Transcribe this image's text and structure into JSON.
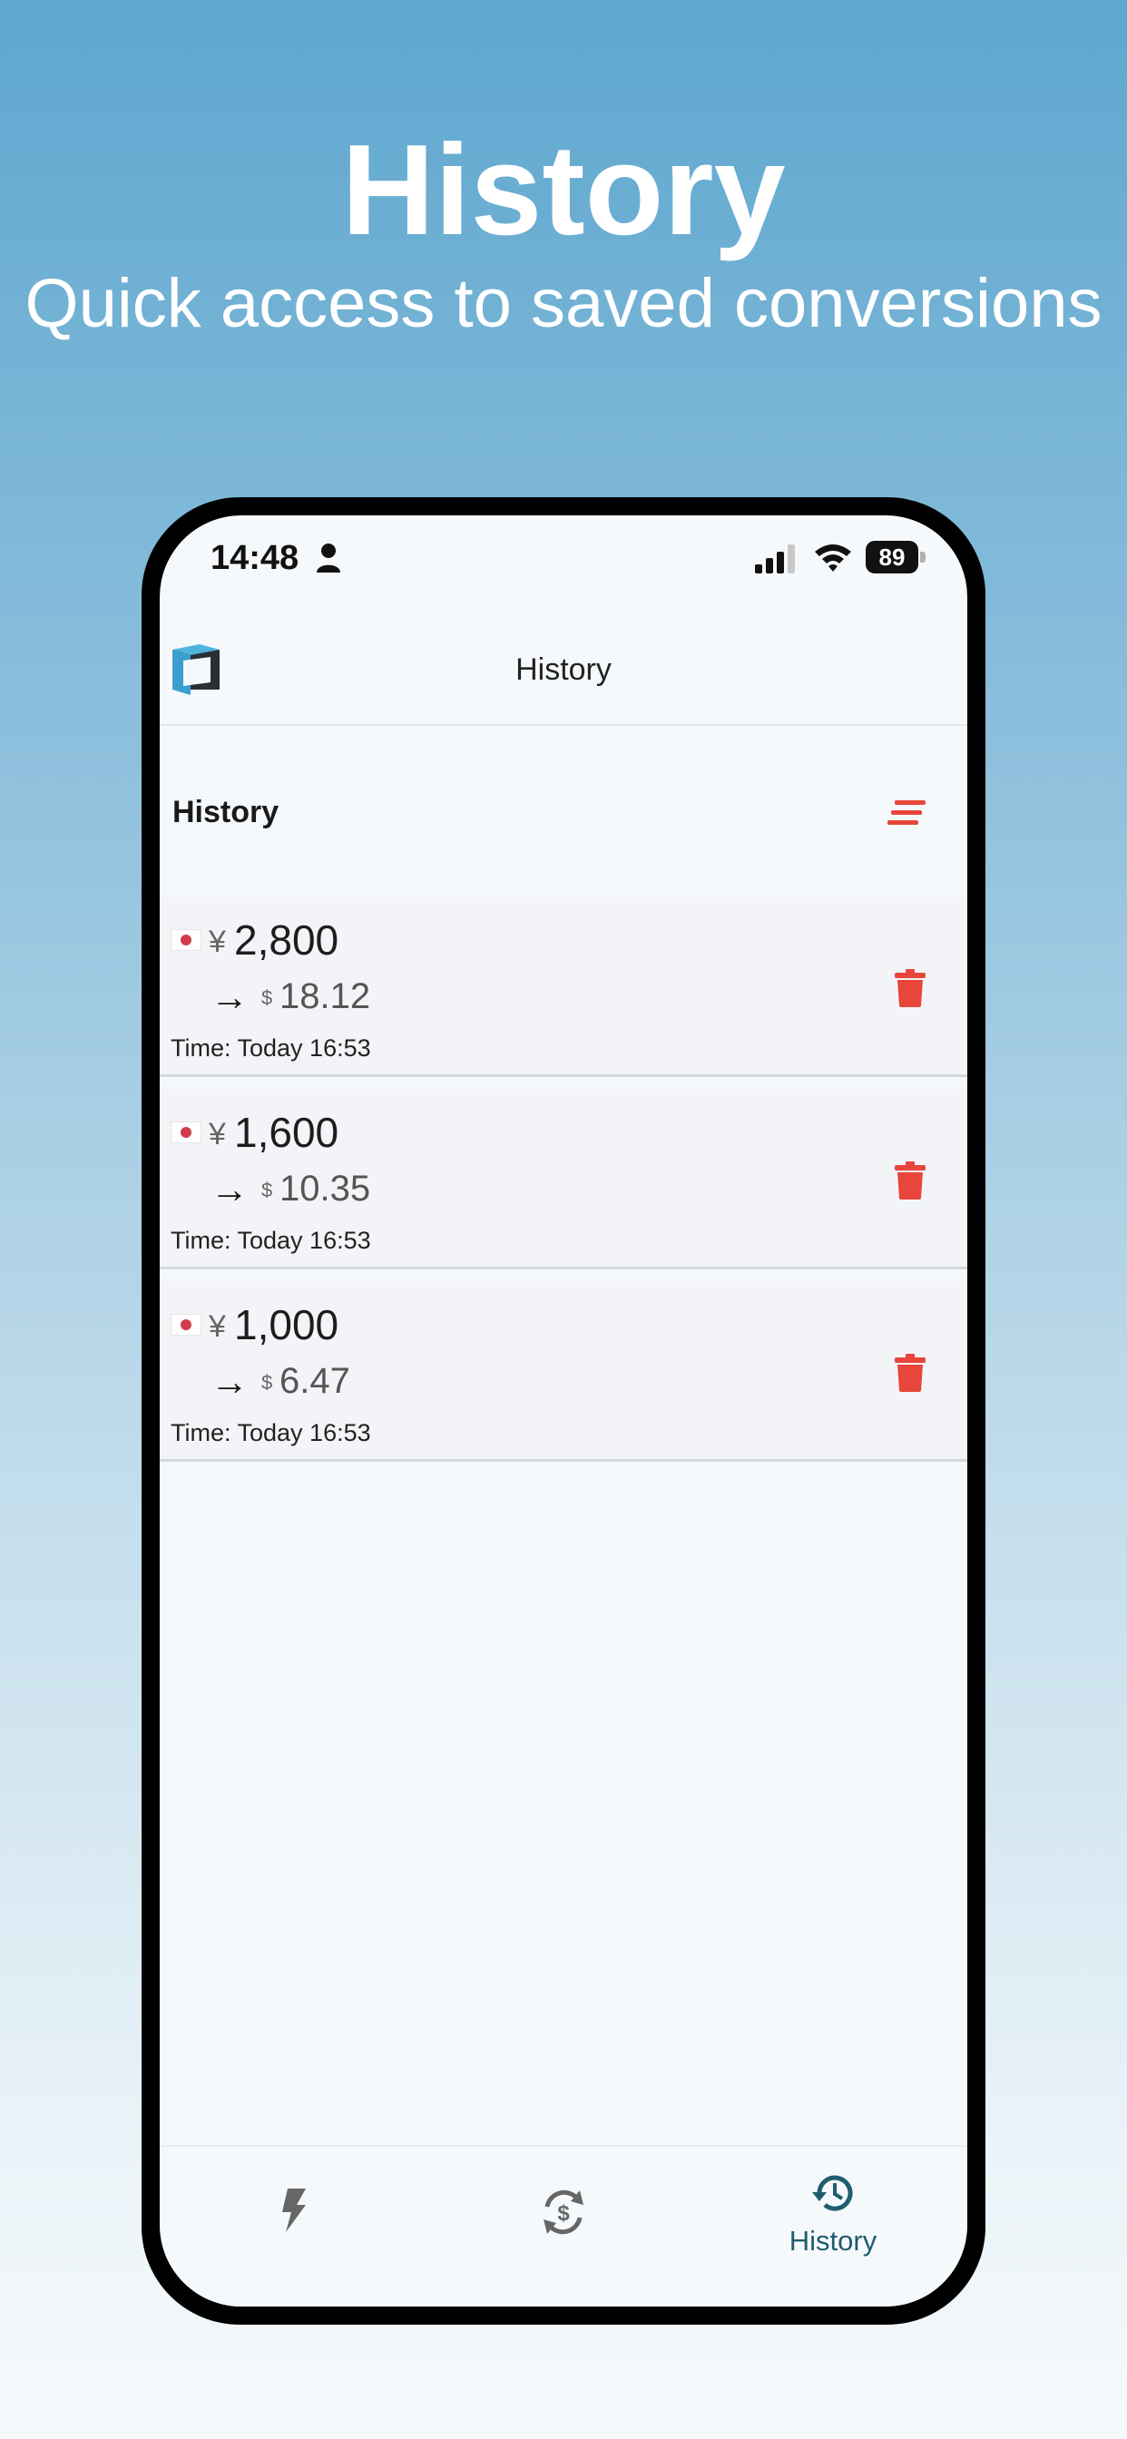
{
  "hero": {
    "title": "History",
    "subtitle": "Quick access to saved conversions"
  },
  "status_bar": {
    "time": "14:48",
    "battery": "89",
    "icons": [
      "person-icon",
      "signal-icon",
      "wifi-icon",
      "battery-icon"
    ]
  },
  "header": {
    "title": "History",
    "logo_icon": "app-logo-cube"
  },
  "section": {
    "title": "History",
    "sort_icon": "sort-lines-icon"
  },
  "history": [
    {
      "flag": "japan-flag-icon",
      "from_symbol": "¥",
      "from_amount": "2,800",
      "arrow": "→",
      "to_symbol": "$",
      "to_amount": "18.12",
      "time": "Time: Today 16:53"
    },
    {
      "flag": "japan-flag-icon",
      "from_symbol": "¥",
      "from_amount": "1,600",
      "arrow": "→",
      "to_symbol": "$",
      "to_amount": "10.35",
      "time": "Time: Today 16:53"
    },
    {
      "flag": "japan-flag-icon",
      "from_symbol": "¥",
      "from_amount": "1,000",
      "arrow": "→",
      "to_symbol": "$",
      "to_amount": "6.47",
      "time": "Time: Today 16:53"
    }
  ],
  "tabs": [
    {
      "icon": "lightning-icon",
      "label": ""
    },
    {
      "icon": "currency-exchange-icon",
      "label": ""
    },
    {
      "icon": "history-clock-icon",
      "label": "History",
      "active": true
    }
  ],
  "colors": {
    "accent": "#1f5d6e",
    "delete": "#e8453c",
    "sort": "#e8453c",
    "inactive_icon": "#666666"
  }
}
